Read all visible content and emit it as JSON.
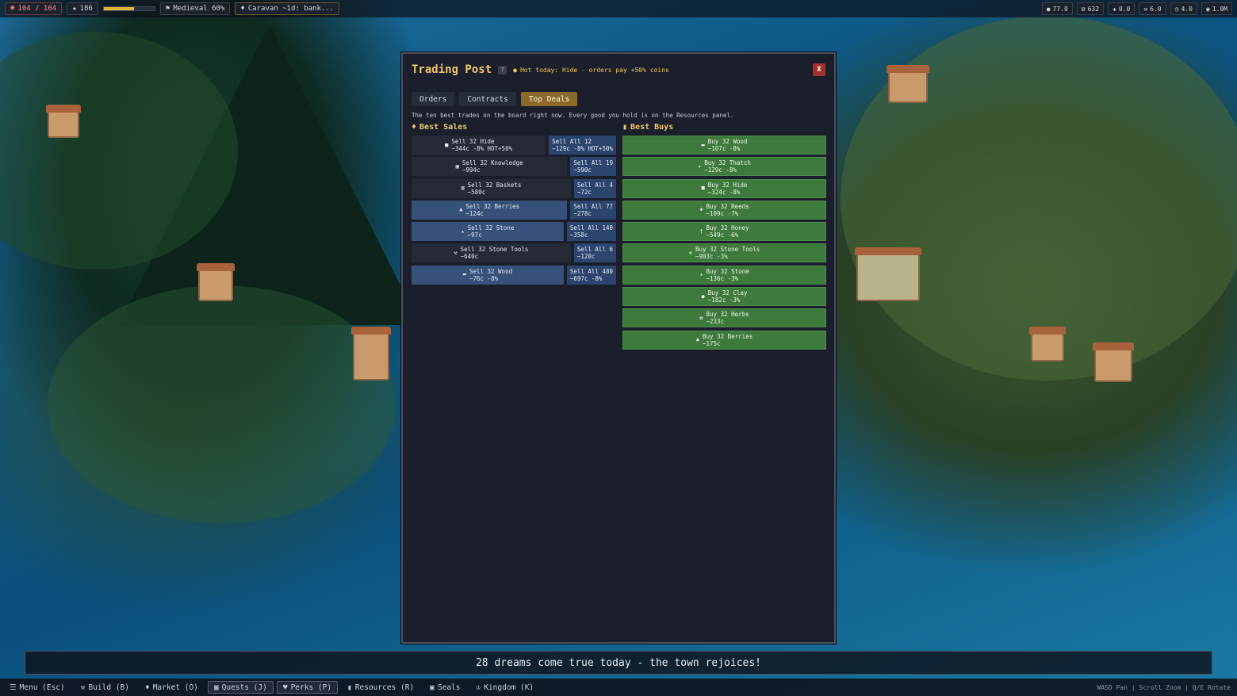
{
  "topbar": {
    "population": "104 / 104",
    "stars": "186",
    "era_progress": 0.6,
    "era": "Medieval 60%",
    "caravan": "Caravan ~1d: bank...",
    "stats": [
      "77.0",
      "632",
      "0.0",
      "6.0",
      "4.0",
      "1.0M"
    ]
  },
  "modal": {
    "title": "Trading Post",
    "help": "?",
    "hot": "Hot today: Hide - orders pay +50% coins",
    "close": "X",
    "tabs": [
      "Orders",
      "Contracts",
      "Top Deals"
    ],
    "active_tab": "Top Deals",
    "intro": "The ten best trades on the board right now. Every good you hold is on the Resources panel.",
    "sales_title": "Best Sales",
    "buys_title": "Best Buys",
    "sales": [
      {
        "sell": "Sell 32 Hide",
        "sell_price": "~344c -8% HOT+50%",
        "all": "Sell All 12",
        "all_price": "~129c -8% HOT+50%",
        "highlight": false
      },
      {
        "sell": "Sell 32 Knowledge",
        "sell_price": "~994c",
        "all": "Sell All 19",
        "all_price": "~590c",
        "highlight": false
      },
      {
        "sell": "Sell 32 Baskets",
        "sell_price": "~580c",
        "all": "Sell All 4",
        "all_price": "~72c",
        "highlight": false
      },
      {
        "sell": "Sell 32 Berries",
        "sell_price": "~124c",
        "all": "Sell All 77",
        "all_price": "~278c",
        "highlight": true
      },
      {
        "sell": "Sell 32 Stone",
        "sell_price": "~97c",
        "all": "Sell All 140",
        "all_price": "~358c",
        "highlight": true
      },
      {
        "sell": "Sell 32 Stone Tools",
        "sell_price": "~640c",
        "all": "Sell All 6",
        "all_price": "~120c",
        "highlight": false
      },
      {
        "sell": "Sell 32 Wood",
        "sell_price": "~76c -8%",
        "all": "Sell All 480",
        "all_price": "~697c -8%",
        "highlight": true
      }
    ],
    "buys": [
      {
        "label": "Buy 32 Wood",
        "price": "~107c -8%"
      },
      {
        "label": "Buy 32 Thatch",
        "price": "~129c -8%"
      },
      {
        "label": "Buy 32 Hide",
        "price": "~324c -8%"
      },
      {
        "label": "Buy 32 Reeds",
        "price": "~109c -7%"
      },
      {
        "label": "Buy 32 Honey",
        "price": "~549c -6%"
      },
      {
        "label": "Buy 32 Stone Tools",
        "price": "~903c -3%"
      },
      {
        "label": "Buy 32 Stone",
        "price": "~136c -3%"
      },
      {
        "label": "Buy 32 Clay",
        "price": "~182c -3%"
      },
      {
        "label": "Buy 32 Herbs",
        "price": "~233c"
      },
      {
        "label": "Buy 32 Berries",
        "price": "~175c"
      }
    ]
  },
  "message": "28 dreams come true today - the town rejoices!",
  "bottombar": {
    "buttons": [
      "Menu (Esc)",
      "Build (B)",
      "Market (O)",
      "Quests (J)",
      "Perks (P)",
      "Resources (R)",
      "Seals",
      "Kingdom (K)"
    ],
    "hint": "WASD Pan | Scroll Zoom | Q/E Rotate"
  },
  "colors": {
    "accent": "#f0c76a",
    "sell_highlight": "#36527a",
    "buy": "#3d7a3c",
    "close": "#a3312b"
  }
}
